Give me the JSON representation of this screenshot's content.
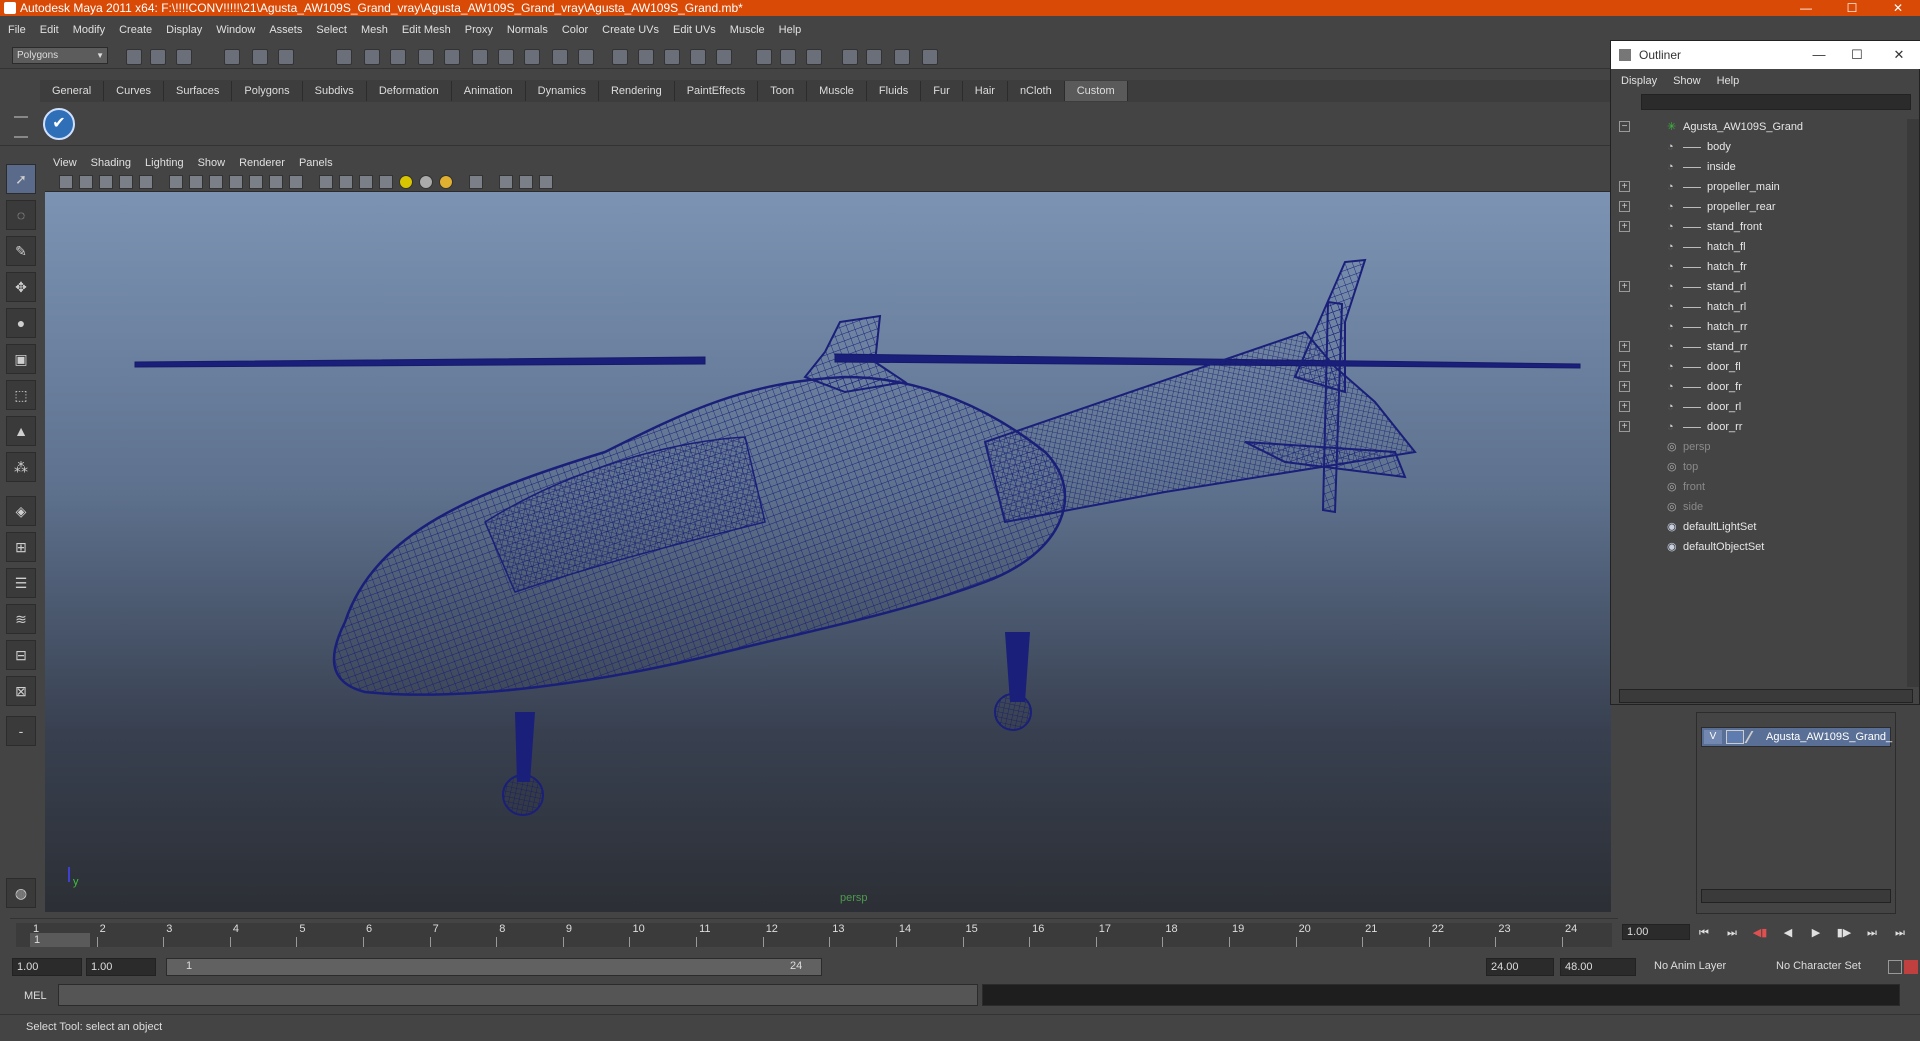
{
  "window": {
    "title": "Autodesk Maya 2011 x64: F:\\!!!!CONV!!!!!\\21\\Agusta_AW109S_Grand_vray\\Agusta_AW109S_Grand_vray\\Agusta_AW109S_Grand.mb*",
    "minimize": "—",
    "maximize": "☐",
    "close": "✕"
  },
  "menubar": [
    "File",
    "Edit",
    "Modify",
    "Create",
    "Display",
    "Window",
    "Assets",
    "Select",
    "Mesh",
    "Edit Mesh",
    "Proxy",
    "Normals",
    "Color",
    "Create UVs",
    "Edit UVs",
    "Muscle",
    "Help"
  ],
  "toolbar": {
    "mode": "Polygons"
  },
  "shelf": {
    "tabs": [
      "General",
      "Curves",
      "Surfaces",
      "Polygons",
      "Subdivs",
      "Deformation",
      "Animation",
      "Dynamics",
      "Rendering",
      "PaintEffects",
      "Toon",
      "Muscle",
      "Fluids",
      "Fur",
      "Hair",
      "nCloth",
      "Custom"
    ],
    "active_tab": "Custom",
    "custom_button_icon": "check-icon"
  },
  "viewport": {
    "menu": [
      "View",
      "Shading",
      "Lighting",
      "Show",
      "Renderer",
      "Panels"
    ],
    "camera_label": "persp",
    "axis_y": "y",
    "wireframe_color": "#1a1f7a"
  },
  "outliner": {
    "title": "Outliner",
    "minimize": "—",
    "maximize": "☐",
    "close": "✕",
    "menu": [
      "Display",
      "Show",
      "Help"
    ],
    "items": [
      {
        "label": "Agusta_AW109S_Grand",
        "kind": "top",
        "expand": "−"
      },
      {
        "label": "body",
        "kind": "child",
        "expand": ""
      },
      {
        "label": "inside",
        "kind": "child",
        "expand": ""
      },
      {
        "label": "propeller_main",
        "kind": "child",
        "expand": "+"
      },
      {
        "label": "propeller_rear",
        "kind": "child",
        "expand": "+"
      },
      {
        "label": "stand_front",
        "kind": "child",
        "expand": "+"
      },
      {
        "label": "hatch_fl",
        "kind": "child",
        "expand": ""
      },
      {
        "label": "hatch_fr",
        "kind": "child",
        "expand": ""
      },
      {
        "label": "stand_rl",
        "kind": "child",
        "expand": "+"
      },
      {
        "label": "hatch_rl",
        "kind": "child",
        "expand": ""
      },
      {
        "label": "hatch_rr",
        "kind": "child",
        "expand": ""
      },
      {
        "label": "stand_rr",
        "kind": "child",
        "expand": "+"
      },
      {
        "label": "door_fl",
        "kind": "child",
        "expand": "+"
      },
      {
        "label": "door_fr",
        "kind": "child",
        "expand": "+"
      },
      {
        "label": "door_rl",
        "kind": "child",
        "expand": "+"
      },
      {
        "label": "door_rr",
        "kind": "child",
        "expand": "+"
      },
      {
        "label": "persp",
        "kind": "camera",
        "expand": ""
      },
      {
        "label": "top",
        "kind": "camera",
        "expand": ""
      },
      {
        "label": "front",
        "kind": "camera",
        "expand": ""
      },
      {
        "label": "side",
        "kind": "camera",
        "expand": ""
      },
      {
        "label": "defaultLightSet",
        "kind": "set",
        "expand": ""
      },
      {
        "label": "defaultObjectSet",
        "kind": "set",
        "expand": ""
      }
    ]
  },
  "layers": {
    "visible_flag": "V",
    "name": "Agusta_AW109S_Grand_"
  },
  "timeline": {
    "ticks": [
      "1",
      "2",
      "3",
      "4",
      "5",
      "6",
      "7",
      "8",
      "9",
      "10",
      "11",
      "12",
      "13",
      "14",
      "15",
      "16",
      "17",
      "18",
      "19",
      "20",
      "21",
      "22",
      "23",
      "24"
    ],
    "current_frame": "1.00",
    "playhead": "1"
  },
  "range": {
    "start": "1.00",
    "playback_start": "1.00",
    "slider_start": "1",
    "slider_end": "24",
    "playback_end": "24.00",
    "end": "48.00",
    "anim_layer": "No Anim Layer",
    "character_set": "No Character Set"
  },
  "command": {
    "label": "MEL"
  },
  "status": {
    "text": "Select Tool: select an object"
  }
}
